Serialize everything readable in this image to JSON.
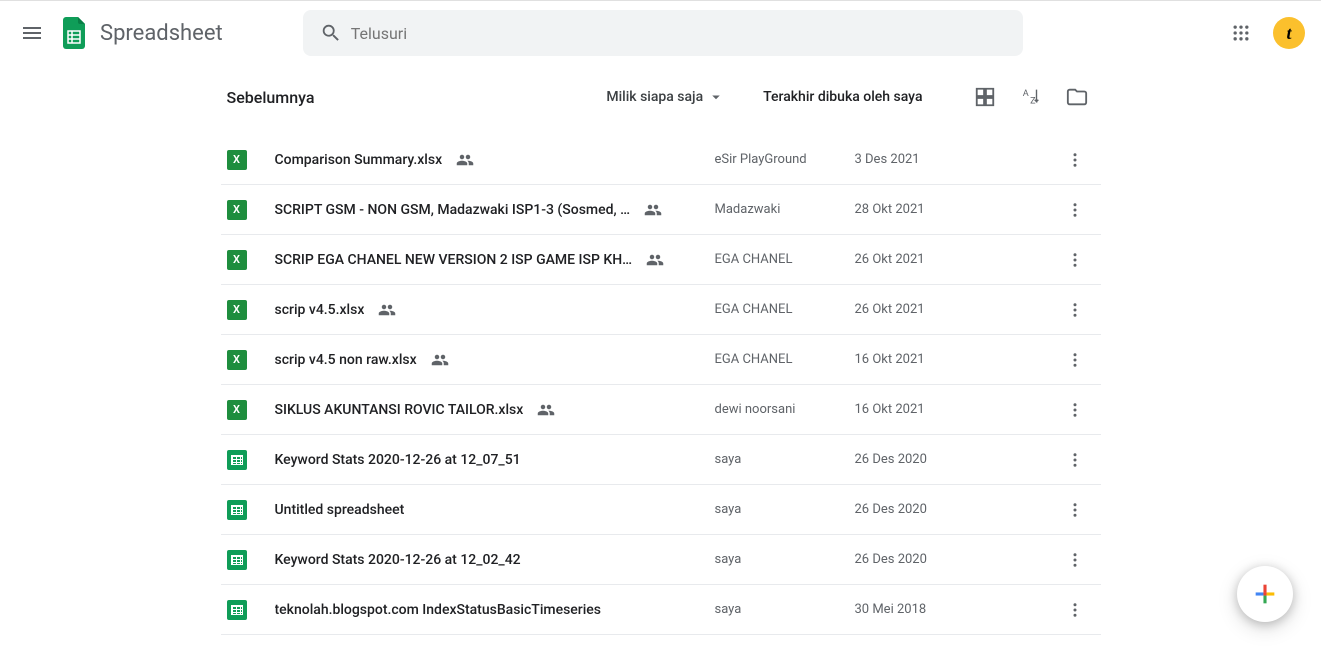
{
  "header": {
    "app_title": "Spreadsheet",
    "search_placeholder": "Telusuri",
    "avatar_letter": "t"
  },
  "toolbar": {
    "section_title": "Sebelumnya",
    "owner_filter": "Milik siapa saja",
    "sort_label": "Terakhir dibuka oleh saya"
  },
  "files": [
    {
      "name": "Comparison Summary.xlsx",
      "owner": "eSir PlayGround",
      "date": "3 Des 2021",
      "type": "excel",
      "shared": true
    },
    {
      "name": "SCRIPT GSM - NON GSM, Madazwaki ISP1-3 (Sosmed, …",
      "owner": "Madazwaki",
      "date": "28 Okt 2021",
      "type": "excel",
      "shared": true
    },
    {
      "name": "SCRIP EGA CHANEL NEW VERSION 2 ISP GAME ISP KH…",
      "owner": "EGA CHANEL",
      "date": "26 Okt 2021",
      "type": "excel",
      "shared": true
    },
    {
      "name": "scrip v4.5.xlsx",
      "owner": "EGA CHANEL",
      "date": "26 Okt 2021",
      "type": "excel",
      "shared": true
    },
    {
      "name": "scrip v4.5 non raw.xlsx",
      "owner": "EGA CHANEL",
      "date": "16 Okt 2021",
      "type": "excel",
      "shared": true
    },
    {
      "name": "SIKLUS AKUNTANSI ROVIC TAILOR.xlsx",
      "owner": "dewi noorsani",
      "date": "16 Okt 2021",
      "type": "excel",
      "shared": true
    },
    {
      "name": "Keyword Stats 2020-12-26 at 12_07_51",
      "owner": "saya",
      "date": "26 Des 2020",
      "type": "sheets",
      "shared": false
    },
    {
      "name": "Untitled spreadsheet",
      "owner": "saya",
      "date": "26 Des 2020",
      "type": "sheets",
      "shared": false
    },
    {
      "name": "Keyword Stats 2020-12-26 at 12_02_42",
      "owner": "saya",
      "date": "26 Des 2020",
      "type": "sheets",
      "shared": false
    },
    {
      "name": "teknolah.blogspot.com IndexStatusBasicTimeseries",
      "owner": "saya",
      "date": "30 Mei 2018",
      "type": "sheets",
      "shared": false
    }
  ]
}
